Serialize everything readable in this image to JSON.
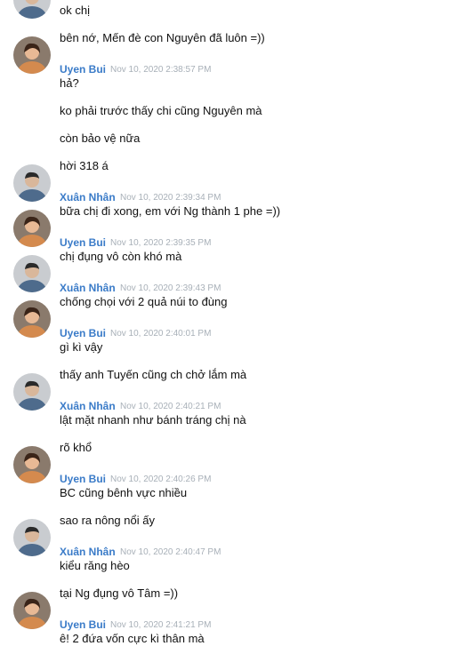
{
  "users": {
    "uyen": {
      "name": "Uyen Bui",
      "avatar_icon": "user-avatar-uyen",
      "avatar_color": "#c9875a"
    },
    "nhan": {
      "name": "Xuân Nhân",
      "avatar_icon": "user-avatar-nhan",
      "avatar_color": "#5b6f86"
    }
  },
  "colors": {
    "name": "#3a7bc8",
    "timestamp": "#a8b0b8",
    "text": "#111111"
  },
  "messages": [
    {
      "sender": "nhan",
      "show_header": false,
      "show_avatar": true,
      "time": "",
      "text": "ok chị"
    },
    {
      "sender": "nhan",
      "show_header": false,
      "show_avatar": false,
      "time": "",
      "text": "bên nớ, Mến đè con Nguyên đã luôn =))"
    },
    {
      "sender": "uyen",
      "show_header": true,
      "show_avatar": true,
      "time": "Nov 10, 2020 2:38:57 PM",
      "text": "hả?"
    },
    {
      "sender": "uyen",
      "show_header": false,
      "show_avatar": false,
      "time": "",
      "text": "ko phải trước thấy chi cũng Nguyên mà"
    },
    {
      "sender": "uyen",
      "show_header": false,
      "show_avatar": false,
      "time": "",
      "text": "còn bảo vệ nữa"
    },
    {
      "sender": "uyen",
      "show_header": false,
      "show_avatar": false,
      "time": "",
      "text": "hời 318 á"
    },
    {
      "sender": "nhan",
      "show_header": true,
      "show_avatar": true,
      "time": "Nov 10, 2020 2:39:34 PM",
      "text": "bữa chị đi xong, em với Ng thành 1 phe =))"
    },
    {
      "sender": "uyen",
      "show_header": true,
      "show_avatar": true,
      "time": "Nov 10, 2020 2:39:35 PM",
      "text": "chị đụng vô còn khó mà"
    },
    {
      "sender": "nhan",
      "show_header": true,
      "show_avatar": true,
      "time": "Nov 10, 2020 2:39:43 PM",
      "text": "chống chọi với 2 quả núi to đùng"
    },
    {
      "sender": "uyen",
      "show_header": true,
      "show_avatar": true,
      "time": "Nov 10, 2020 2:40:01 PM",
      "text": "gì kì vậy"
    },
    {
      "sender": "uyen",
      "show_header": false,
      "show_avatar": false,
      "time": "",
      "text": "thấy anh Tuyến cũng ch chở lắm mà"
    },
    {
      "sender": "nhan",
      "show_header": true,
      "show_avatar": true,
      "time": "Nov 10, 2020 2:40:21 PM",
      "text": "lật mặt nhanh như bánh tráng chị nà"
    },
    {
      "sender": "nhan",
      "show_header": false,
      "show_avatar": false,
      "time": "",
      "text": "rõ khổ"
    },
    {
      "sender": "uyen",
      "show_header": true,
      "show_avatar": true,
      "time": "Nov 10, 2020 2:40:26 PM",
      "text": "BC cũng bênh vực nhiều"
    },
    {
      "sender": "uyen",
      "show_header": false,
      "show_avatar": false,
      "time": "",
      "text": "sao ra nông nổi ấy"
    },
    {
      "sender": "nhan",
      "show_header": true,
      "show_avatar": true,
      "time": "Nov 10, 2020 2:40:47 PM",
      "text": "kiểu răng hèo"
    },
    {
      "sender": "nhan",
      "show_header": false,
      "show_avatar": false,
      "time": "",
      "text": "tại Ng đụng vô Tâm =))"
    },
    {
      "sender": "uyen",
      "show_header": true,
      "show_avatar": true,
      "time": "Nov 10, 2020 2:41:21 PM",
      "text": "ê! 2 đứa vốn cực kì thân mà"
    }
  ]
}
